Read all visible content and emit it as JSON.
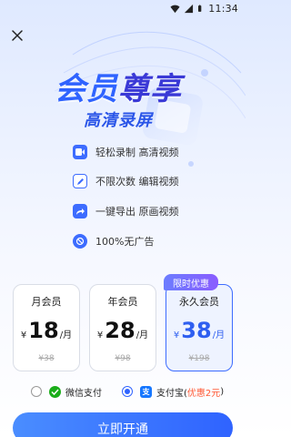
{
  "status_bar": {
    "time": "11:34"
  },
  "hero": {
    "title_part1": "会员",
    "title_part2": "尊享",
    "subtitle": "高清录屏"
  },
  "features": [
    {
      "icon": "video-record-icon",
      "color": "#3d6cff",
      "label": "轻松录制 高清视频"
    },
    {
      "icon": "edit-icon",
      "color": "#3d6cff",
      "label": "不限次数 编辑视频"
    },
    {
      "icon": "share-export-icon",
      "color": "#3d6cff",
      "label": "一键导出 原画视频"
    },
    {
      "icon": "no-ads-icon",
      "color": "#3d6cff",
      "label": "100%无广告"
    }
  ],
  "plans": [
    {
      "name": "月会员",
      "currency": "¥",
      "price": "18",
      "per": "/月",
      "original": "¥38",
      "selected": false
    },
    {
      "name": "年会员",
      "currency": "¥",
      "price": "28",
      "per": "/月",
      "original": "¥98",
      "selected": false
    },
    {
      "name": "永久会员",
      "currency": "¥",
      "price": "38",
      "per": "/月",
      "original": "¥198",
      "selected": true
    }
  ],
  "badge": "限时优惠",
  "payment": {
    "wechat": {
      "label": "微信支付",
      "icon": "wechat-pay-icon",
      "color": "#1aad19",
      "selected": false
    },
    "alipay": {
      "label": "支付宝(",
      "promo": "优惠2元",
      "close": ")",
      "icon": "alipay-icon",
      "color": "#1677ff",
      "selected": true
    }
  },
  "cta_label": "立即开通",
  "colors": {
    "accent": "#2f63ff",
    "promo": "#ff5a36"
  }
}
